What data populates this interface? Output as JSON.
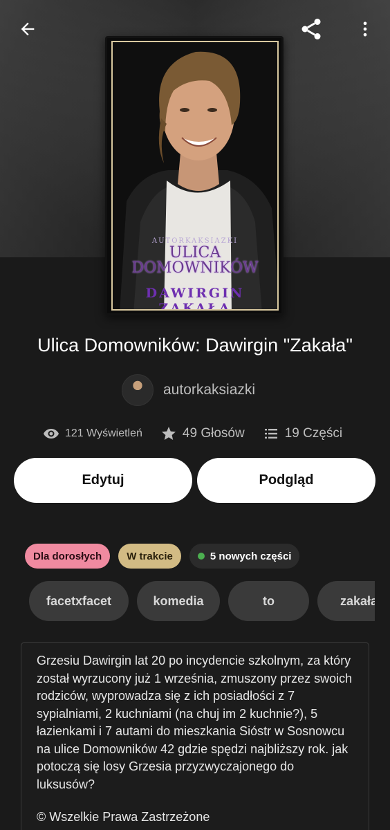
{
  "header": {
    "back_icon": "arrow-left-icon",
    "share_icon": "share-icon",
    "more_icon": "more-vert-icon"
  },
  "cover": {
    "author_text": "AUTORKAKSIAZKI",
    "title_line1": "ULICA",
    "title_line2": "DOMOWNIKÓW",
    "subtitle": "DAWIRGIN ZAKAŁA"
  },
  "book": {
    "title": "Ulica Domowników: Dawirgin \"Zakała\"",
    "author": "autorkaksiazki"
  },
  "stats": {
    "views": "121 Wyświetleń",
    "votes": "49 Głosów",
    "parts": "19 Części"
  },
  "actions": {
    "edit_label": "Edytuj",
    "preview_label": "Podgląd"
  },
  "badges": {
    "mature": "Dla dorosłych",
    "ongoing": "W trakcie",
    "new_parts": "5 nowych części"
  },
  "tags": [
    "facetxfacet",
    "komedia",
    "to",
    "zakała"
  ],
  "description": {
    "text": "Grzesiu Dawirgin lat 20 po incydencie szkolnym, za który został wyrzucony już 1 września, zmuszony przez swoich rodziców, wyprowadza się z ich posiadłości z 7 sypialniami, 2 kuchniami (na chuj im 2 kuchnie?), 5 łazienkami i 7 autami do mieszkania Sióstr w Sosnowcu na ulice Domowników 42 gdzie spędzi najbliższy rok. jak potoczą się losy Grzesia przyzwyczajonego do luksusów?",
    "copyright": "© Wszelkie Prawa Zastrzeżone"
  },
  "colors": {
    "background": "#1a1a1a",
    "mature_badge": "#f08aa0",
    "ongoing_badge": "#d2bb84",
    "new_dot": "#4caf50",
    "tag_bg": "#3a3a3a"
  }
}
